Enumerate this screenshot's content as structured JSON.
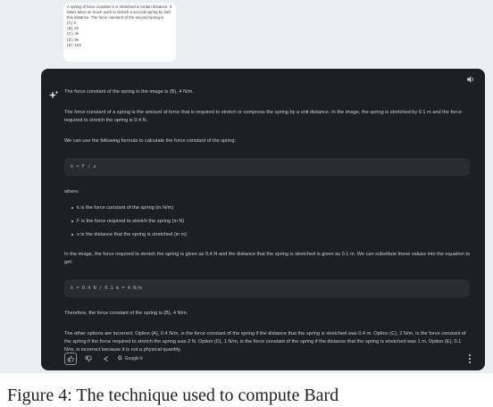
{
  "thumbnail": {
    "question": "A spring of force constant k is stretched a certain distance. It takes twice as much work to stretch a second spring by half this distance. The force constant of the second spring is",
    "options": [
      "(A)  k",
      "(B)  2k",
      "(C)  4k",
      "(D)  8k",
      "(E)  16k"
    ]
  },
  "response": {
    "intro": "The force constant of the spring in the image is (B), 4 N/m.",
    "explanation": "The force constant of a spring is the amount of force that is required to stretch or compress the spring by a unit distance. In the image, the spring is stretched by 0.1 m and the force required to stretch the spring is 0.4 N.",
    "formula_lead": "We can use the following formula to calculate the force constant of the spring:",
    "formula": "k = F / x",
    "where": "where:",
    "definitions": [
      "k is the force constant of the spring (in N/m)",
      "F is the force required to stretch the spring (in N)",
      "x is the distance that the spring is stretched (in m)"
    ],
    "substitution_lead": "In the image, the force required to stretch the spring is given as 0.4 N and the distance that the spring is stretched is given as 0.1 m. We can substitute these values into the equation to get:",
    "calc": "k = 0.4 N / 0.1 m = 4 N/m",
    "conclusion": "Therefore, the force constant of the spring is (B), 4 N/m.",
    "other_options": "The other options are incorrect. Option (A), 0.4 N/m, is the force constant of the spring if the distance that the spring is stretched was 0.4 m. Option (C), 2 N/m, is the force constant of the spring if the force required to stretch the spring was 2 N. Option (D), 1 N/m, is the force constant of the spring if the distance that the spring is stretched was 1 m. Option (E), 0.1 N/m, is incorrect because it is not a physical quantity."
  },
  "actions": {
    "google_label": "Google it"
  },
  "icons": {
    "speaker": "volume-icon",
    "sparkle": "sparkle-icon",
    "thumbs_up": "thumbs-up-icon",
    "thumbs_down": "thumbs-down-icon",
    "share": "share-icon",
    "google": "google-icon",
    "more": "more-vertical-icon"
  },
  "caption": "Figure 4: The technique used to compute Bard"
}
